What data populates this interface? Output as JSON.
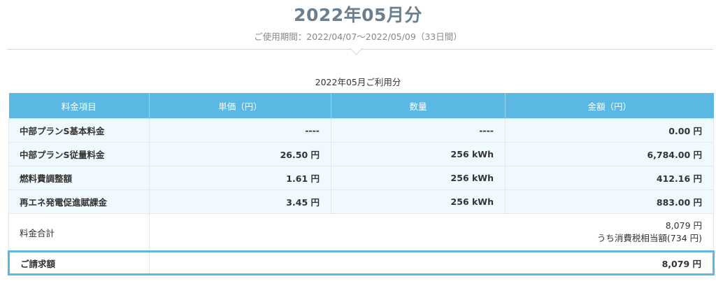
{
  "header": {
    "title": "2022年05月分",
    "period_label": "ご使用期間：2022/04/07〜2022/05/09（33日間）"
  },
  "table_caption": "2022年05月ご利用分",
  "columns": [
    "料金項目",
    "単価（円）",
    "数量",
    "金額（円）"
  ],
  "rows": [
    {
      "item": "中部プランS基本料金",
      "unit_price": "----",
      "quantity": "----",
      "amount": "0.00 円"
    },
    {
      "item": "中部プランS従量料金",
      "unit_price": "26.50 円",
      "quantity": "256 kWh",
      "amount": "6,784.00 円"
    },
    {
      "item": "燃料費調整額",
      "unit_price": "1.61 円",
      "quantity": "256 kWh",
      "amount": "412.16 円"
    },
    {
      "item": "再エネ発電促進賦課金",
      "unit_price": "3.45 円",
      "quantity": "256 kWh",
      "amount": "883.00 円"
    }
  ],
  "total": {
    "label": "料金合計",
    "amount": "8,079 円",
    "tax_note": "うち消費税相当額(734 円)"
  },
  "billing": {
    "label": "ご請求額",
    "amount": "8,079 円"
  },
  "colors": {
    "header_bg": "#5bb8e3",
    "row_bg": "#f0f9fd",
    "title": "#6b7f8e",
    "highlight_border": "#5bb8e3"
  }
}
